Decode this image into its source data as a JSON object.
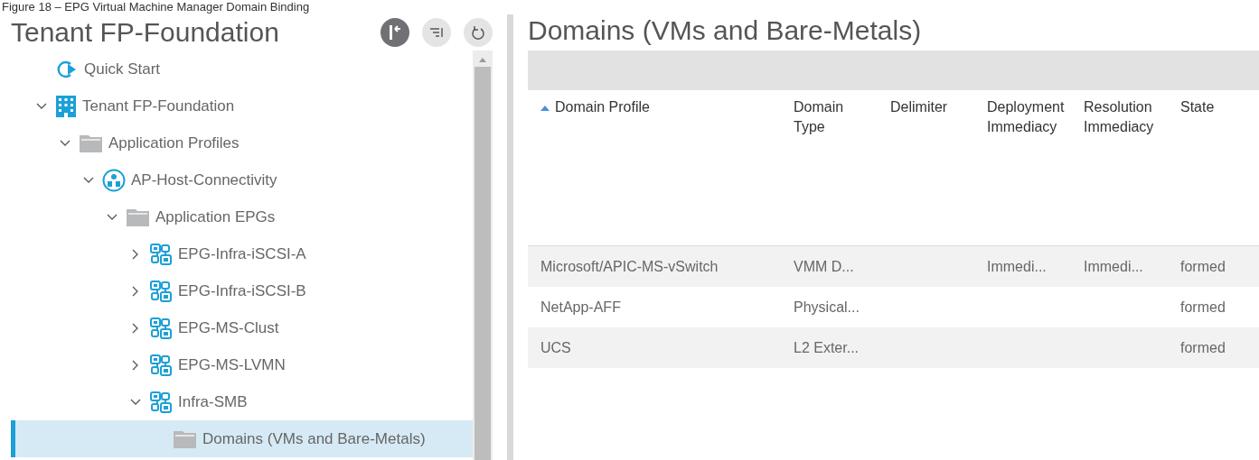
{
  "caption": "Figure 18 – EPG Virtual Machine Manager Domain Binding",
  "left_panel": {
    "title": "Tenant FP-Foundation"
  },
  "tree": [
    {
      "label": "Quick Start",
      "kind": "quickstart",
      "selected": false
    },
    {
      "label": "Tenant FP-Foundation",
      "kind": "tenant",
      "expanded": true,
      "selected": false,
      "children": [
        {
          "label": "Application Profiles",
          "kind": "folder",
          "expanded": true,
          "selected": false,
          "children": [
            {
              "label": "AP-Host-Connectivity",
              "kind": "profile",
              "expanded": true,
              "selected": false,
              "children": [
                {
                  "label": "Application EPGs",
                  "kind": "folder",
                  "expanded": true,
                  "selected": false,
                  "children": [
                    {
                      "label": "EPG-Infra-iSCSI-A",
                      "kind": "epg",
                      "expanded": false,
                      "selected": false
                    },
                    {
                      "label": "EPG-Infra-iSCSI-B",
                      "kind": "epg",
                      "expanded": false,
                      "selected": false
                    },
                    {
                      "label": "EPG-MS-Clust",
                      "kind": "epg",
                      "expanded": false,
                      "selected": false
                    },
                    {
                      "label": "EPG-MS-LVMN",
                      "kind": "epg",
                      "expanded": false,
                      "selected": false
                    },
                    {
                      "label": "Infra-SMB",
                      "kind": "epg",
                      "expanded": true,
                      "selected": false,
                      "children": [
                        {
                          "label": "Domains (VMs and Bare-Metals)",
                          "kind": "folder",
                          "selected": true
                        }
                      ]
                    }
                  ]
                }
              ]
            }
          ]
        }
      ]
    }
  ],
  "right_panel": {
    "title": "Domains (VMs and Bare-Metals)"
  },
  "table": {
    "columns": [
      {
        "label": "Domain Profile",
        "sorted": true
      },
      {
        "label": "Domain Type",
        "sorted": false
      },
      {
        "label": "Delimiter",
        "sorted": false
      },
      {
        "label": "Deployment Immediacy",
        "sorted": false
      },
      {
        "label": "Resolution Immediacy",
        "sorted": false
      },
      {
        "label": "State",
        "sorted": false
      }
    ],
    "rows": [
      [
        "Microsoft/APIC-MS-vSwitch",
        "VMM D...",
        "",
        "Immedi...",
        "Immedi...",
        "formed"
      ],
      [
        "NetApp-AFF",
        "Physical...",
        "",
        "",
        "",
        "formed"
      ],
      [
        "UCS",
        "L2 Exter...",
        "",
        "",
        "",
        "formed"
      ]
    ]
  }
}
